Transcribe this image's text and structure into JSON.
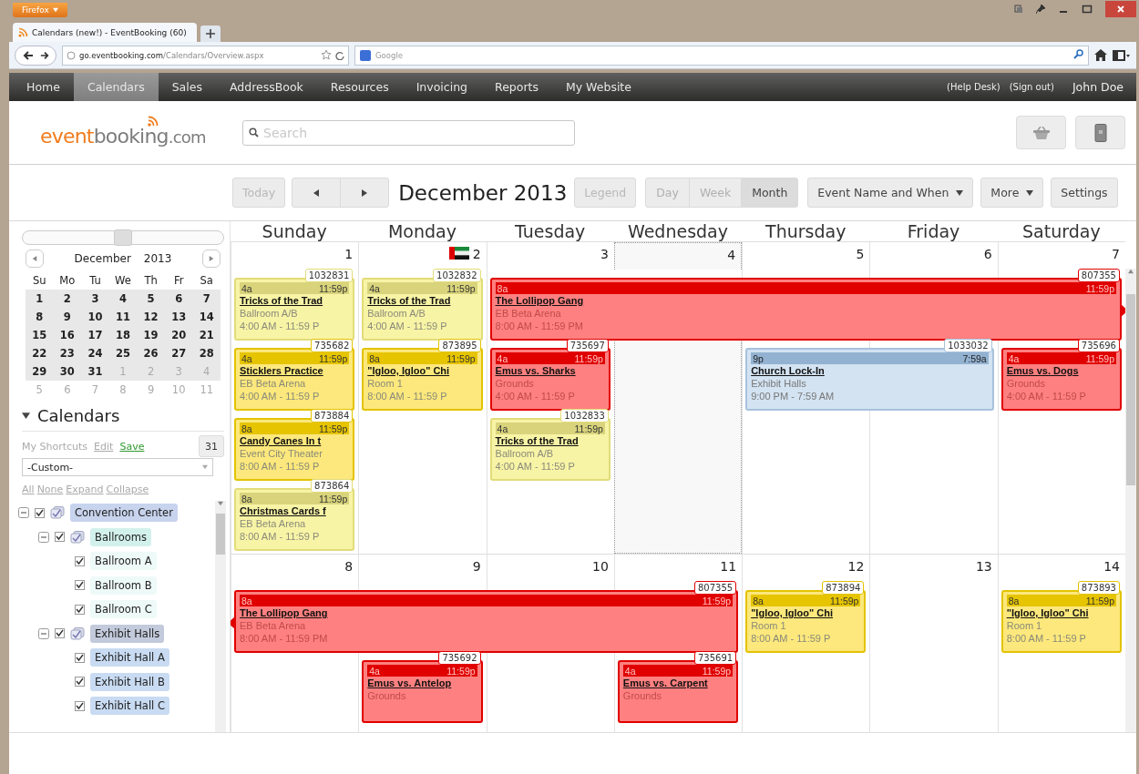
{
  "browser": {
    "menu_button": "Firefox",
    "tab_title": "Calendars (new!) - EventBooking (60)",
    "address_host": "go.eventbooking.com",
    "address_path": "/Calendars/Overview.aspx",
    "search_placeholder": "Google"
  },
  "nav": {
    "items": [
      {
        "label": "Home",
        "selected": false
      },
      {
        "label": "Calendars",
        "selected": true
      },
      {
        "label": "Sales",
        "selected": false
      },
      {
        "label": "AddressBook",
        "selected": false
      },
      {
        "label": "Resources",
        "selected": false
      },
      {
        "label": "Invoicing",
        "selected": false
      },
      {
        "label": "Reports",
        "selected": false
      },
      {
        "label": "My Website",
        "selected": false
      }
    ],
    "links": [
      "(Help Desk)",
      "(Sign out)"
    ],
    "user": "John Doe"
  },
  "header": {
    "logo": [
      "event",
      "booking",
      ".com"
    ],
    "search_placeholder": "Search"
  },
  "toolbar": {
    "today": {
      "label": "Today",
      "disabled": true
    },
    "title": "December 2013",
    "legend": {
      "label": "Legend",
      "disabled": true
    },
    "views": [
      {
        "label": "Day",
        "selected": false
      },
      {
        "label": "Week",
        "selected": false
      },
      {
        "label": "Month",
        "selected": true
      }
    ],
    "display": "Event Name and When",
    "more": "More",
    "settings": "Settings"
  },
  "sidebar": {
    "range_slider": {
      "level": 0.5
    },
    "mini_calendar": {
      "month": "December",
      "year": "2013",
      "weekdays": [
        "Su",
        "Mo",
        "Tu",
        "We",
        "Th",
        "Fr",
        "Sa"
      ],
      "weeks": [
        {
          "days": [
            {
              "day": "1",
              "muted": false
            },
            {
              "day": "2",
              "muted": false
            },
            {
              "day": "3",
              "muted": false
            },
            {
              "day": "4",
              "muted": false
            },
            {
              "day": "5",
              "muted": false
            },
            {
              "day": "6",
              "muted": false
            },
            {
              "day": "7",
              "muted": false
            }
          ]
        },
        {
          "days": [
            {
              "day": "8",
              "muted": false
            },
            {
              "day": "9",
              "muted": false
            },
            {
              "day": "10",
              "muted": false
            },
            {
              "day": "11",
              "muted": false
            },
            {
              "day": "12",
              "muted": false
            },
            {
              "day": "13",
              "muted": false
            },
            {
              "day": "14",
              "muted": false
            }
          ]
        },
        {
          "days": [
            {
              "day": "15",
              "muted": false
            },
            {
              "day": "16",
              "muted": false
            },
            {
              "day": "17",
              "muted": false
            },
            {
              "day": "18",
              "muted": false
            },
            {
              "day": "19",
              "muted": false
            },
            {
              "day": "20",
              "muted": false
            },
            {
              "day": "21",
              "muted": false
            }
          ]
        },
        {
          "days": [
            {
              "day": "22",
              "muted": false
            },
            {
              "day": "23",
              "muted": false
            },
            {
              "day": "24",
              "muted": false
            },
            {
              "day": "25",
              "muted": false
            },
            {
              "day": "26",
              "muted": false
            },
            {
              "day": "27",
              "muted": false
            },
            {
              "day": "28",
              "muted": false
            }
          ]
        },
        {
          "days": [
            {
              "day": "29",
              "muted": false
            },
            {
              "day": "30",
              "muted": false
            },
            {
              "day": "31",
              "muted": false
            },
            {
              "day": "1",
              "muted": true
            },
            {
              "day": "2",
              "muted": true
            },
            {
              "day": "3",
              "muted": true
            },
            {
              "day": "4",
              "muted": true
            }
          ]
        },
        {
          "days": [
            {
              "day": "5",
              "muted": true
            },
            {
              "day": "6",
              "muted": true
            },
            {
              "day": "7",
              "muted": true
            },
            {
              "day": "8",
              "muted": true
            },
            {
              "day": "9",
              "muted": true
            },
            {
              "day": "10",
              "muted": true
            },
            {
              "day": "11",
              "muted": true
            }
          ]
        }
      ]
    },
    "calendars_heading": "Calendars",
    "calendars_expanded": true,
    "shortcuts": {
      "label": "My Shortcuts",
      "edit": "Edit",
      "save": "Save",
      "date_button": "31"
    },
    "select_value": "-Custom-",
    "links": [
      "All",
      "None",
      "Expand",
      "Collapse"
    ],
    "tree": [
      {
        "label": "Convention Center",
        "checked": true,
        "expanded": true,
        "color": "#c8d4ee",
        "children": [
          {
            "label": "Ballrooms",
            "checked": true,
            "expanded": true,
            "color": "#d3f1ec",
            "children": [
              {
                "label": "Ballroom A",
                "checked": true,
                "color": "#eefaf8"
              },
              {
                "label": "Ballroom B",
                "checked": true,
                "color": "#eefaf8"
              },
              {
                "label": "Ballroom C",
                "checked": true,
                "color": "#eefaf8"
              }
            ]
          },
          {
            "label": "Exhibit Halls",
            "checked": true,
            "expanded": true,
            "color": "#c2cadb",
            "children": [
              {
                "label": "Exhibit Hall A",
                "checked": true,
                "color": "#c8dbf2"
              },
              {
                "label": "Exhibit Hall B",
                "checked": true,
                "color": "#c8dbf2"
              },
              {
                "label": "Exhibit Hall C",
                "checked": true,
                "color": "#c8dbf2"
              }
            ]
          }
        ]
      }
    ]
  },
  "calendar": {
    "weekdays": [
      "Sunday",
      "Monday",
      "Tuesday",
      "Wednesday",
      "Thursday",
      "Friday",
      "Saturday"
    ],
    "weeks": [
      {
        "days": [
          {
            "number": "1",
            "today": false,
            "flag": false,
            "events": [
              {
                "id": "1032831",
                "start": "4a",
                "end": "11:59p",
                "name": "Tricks of the Trad",
                "location": "Ballroom A/B",
                "time": "4:00 AM - 11:59 P",
                "color": "#f8f4a6",
                "continues_before": false,
                "continues_after": false
              },
              {
                "id": "735682",
                "start": "4a",
                "end": "11:59p",
                "name": "Sticklers Practice",
                "location": "EB Beta Arena",
                "time": "4:00 AM - 11:59 P",
                "color": "#fce87c",
                "continues_before": false,
                "continues_after": false
              },
              {
                "id": "873884",
                "start": "8a",
                "end": "11:59p",
                "name": "Candy Canes In t",
                "location": "Event City Theater",
                "time": "8:00 AM - 11:59 P",
                "color": "#fce87c",
                "continues_before": false,
                "continues_after": false
              },
              {
                "id": "873864",
                "start": "8a",
                "end": "11:59p",
                "name": "Christmas Cards f",
                "location": "EB Beta Arena",
                "time": "8:00 AM - 11:59 P",
                "color": "#f8f4a6",
                "continues_before": false,
                "continues_after": false
              }
            ]
          },
          {
            "number": "2",
            "today": false,
            "flag": true,
            "events": [
              {
                "id": "1032832",
                "start": "4a",
                "end": "11:59p",
                "name": "Tricks of the Trad",
                "location": "Ballroom A/B",
                "time": "4:00 AM - 11:59 P",
                "color": "#f8f4a6",
                "continues_before": false,
                "continues_after": false
              },
              {
                "id": "873895",
                "start": "8a",
                "end": "11:59p",
                "name": "\"Igloo, Igloo\" Chi",
                "location": "Room 1",
                "time": "8:00 AM - 11:59 P",
                "color": "#fce87c",
                "continues_before": false,
                "continues_after": false
              }
            ]
          },
          {
            "number": "3",
            "today": false,
            "flag": false,
            "events": [
              {
                "id": "807355",
                "start": "8a",
                "end": "11:59p",
                "name": "The Lollipop Gang",
                "location": "EB Beta Arena",
                "time": "8:00 AM - 11:59 PM",
                "color": "#ff8080",
                "continues_before": false,
                "continues_after": true
              },
              {
                "id": "735697",
                "start": "4a",
                "end": "11:59p",
                "name": "Emus vs. Sharks",
                "location": "Grounds",
                "time": "4:00 AM - 11:59 P",
                "color": "#ff8080",
                "continues_before": false,
                "continues_after": false
              },
              {
                "id": "1032833",
                "start": "4a",
                "end": "11:59p",
                "name": "Tricks of the Trad",
                "location": "Ballroom A/B",
                "time": "4:00 AM - 11:59 P",
                "color": "#f8f4a6",
                "continues_before": false,
                "continues_after": false
              }
            ]
          },
          {
            "number": "4",
            "today": true,
            "flag": false
          },
          {
            "number": "5",
            "today": false,
            "flag": false,
            "events": [
              {
                "id": "1033032",
                "start": "9p",
                "end": "7:59a",
                "name": "Church Lock-In",
                "location": "Exhibit Halls",
                "time": "9:00 PM - 7:59 AM",
                "color": "#d3e3f2",
                "continues_before": false,
                "continues_after": false
              }
            ]
          },
          {
            "number": "6",
            "today": false,
            "flag": false
          },
          {
            "number": "7",
            "today": false,
            "flag": false,
            "events": [
              {
                "id": "735696",
                "start": "4a",
                "end": "11:59p",
                "name": "Emus vs. Dogs",
                "location": "Grounds",
                "time": "4:00 AM - 11:59 P",
                "color": "#ff8080",
                "continues_before": false,
                "continues_after": false
              }
            ]
          }
        ]
      },
      {
        "days": [
          {
            "number": "8",
            "today": false,
            "flag": false,
            "events": [
              {
                "id": "807355",
                "start": "8a",
                "end": "11:59p",
                "name": "The Lollipop Gang",
                "location": "EB Beta Arena",
                "time": "8:00 AM - 11:59 PM",
                "color": "#ff8080",
                "continues_before": true,
                "continues_after": false
              }
            ]
          },
          {
            "number": "9",
            "today": false,
            "flag": false,
            "events": [
              {
                "id": "735692",
                "start": "4a",
                "end": "11:59p",
                "name": "Emus vs. Antelop",
                "location": "Grounds",
                "color": "#ff8080",
                "continues_before": false,
                "continues_after": false
              }
            ]
          },
          {
            "number": "10",
            "today": false,
            "flag": false
          },
          {
            "number": "11",
            "today": false,
            "flag": false,
            "events": [
              {
                "id": "735691",
                "start": "4a",
                "end": "11:59p",
                "name": "Emus vs. Carpent",
                "location": "Grounds",
                "color": "#ff8080",
                "continues_before": false,
                "continues_after": false
              }
            ]
          },
          {
            "number": "12",
            "today": false,
            "flag": false,
            "events": [
              {
                "id": "873894",
                "start": "8a",
                "end": "11:59p",
                "name": "\"Igloo, Igloo\" Chi",
                "location": "Room 1",
                "time": "8:00 AM - 11:59 P",
                "color": "#fce87c",
                "continues_before": false,
                "continues_after": false
              }
            ]
          },
          {
            "number": "13",
            "today": false,
            "flag": false
          },
          {
            "number": "14",
            "today": false,
            "flag": false,
            "events": [
              {
                "id": "873893",
                "start": "8a",
                "end": "11:59p",
                "name": "\"Igloo, Igloo\" Chi",
                "location": "Room 1",
                "time": "8:00 AM - 11:59 P",
                "color": "#fce87c",
                "continues_before": false,
                "continues_after": false
              }
            ]
          }
        ]
      }
    ]
  }
}
